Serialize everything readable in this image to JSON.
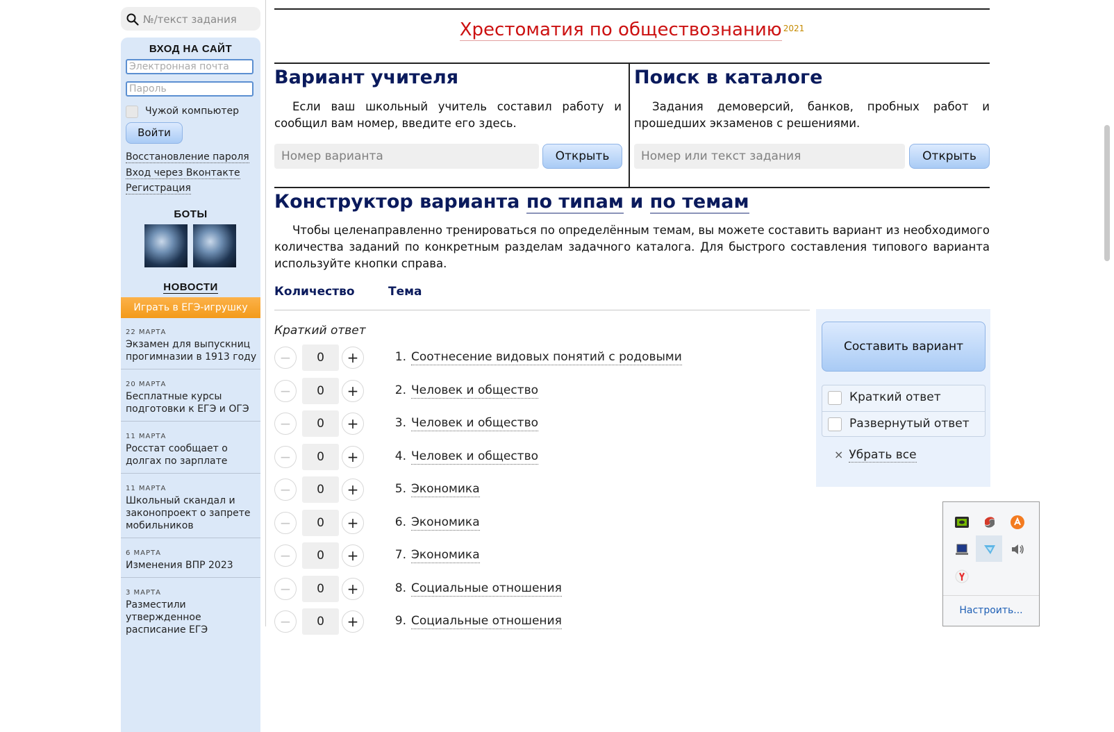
{
  "search": {
    "placeholder": "№/текст задания"
  },
  "login": {
    "heading": "ВХОД НА САЙТ",
    "email_placeholder": "Электронная почта",
    "password_placeholder": "Пароль",
    "remember_label": "Чужой компьютер",
    "submit_label": "Войти",
    "links": [
      "Восстановление пароля",
      "Вход через Вконтакте",
      "Регистрация"
    ]
  },
  "bots": {
    "heading": "БОТЫ"
  },
  "news": {
    "heading": "НОВОСТИ",
    "promo_label": "Играть в ЕГЭ-игрушку",
    "items": [
      {
        "date": "22 МАРТА",
        "title": "Экзамен для выпускниц прогимназии в 1913 году"
      },
      {
        "date": "20 МАРТА",
        "title": "Бесплатные курсы подготовки к ЕГЭ и ОГЭ"
      },
      {
        "date": "11 МАРТА",
        "title": "Росстат сообщает о долгах по зарплате"
      },
      {
        "date": "11 МАРТА",
        "title": "Школьный скандал и законопроект о запрете мобильников"
      },
      {
        "date": "6 МАРТА",
        "title": "Изменения ВПР 2023"
      },
      {
        "date": "3 МАРТА",
        "title": "Разместили утвержденное расписание ЕГЭ"
      }
    ]
  },
  "header": {
    "title": "Хрестоматия по обществознанию",
    "year": "2021"
  },
  "teacher_variant": {
    "heading": "Вариант учителя",
    "text": "Если ваш школьный учитель составил работу и сообщил вам номер, введите его здесь.",
    "input_placeholder": "Номер варианта",
    "button_label": "Открыть"
  },
  "catalog_search": {
    "heading": "Поиск в каталоге",
    "text": "Задания демоверсий, банков, пробных работ и прошедших экзаменов с решениями.",
    "input_placeholder": "Номер или текст задания",
    "button_label": "Открыть"
  },
  "constructor": {
    "heading_prefix": "Конструктор варианта",
    "by_types": "по типам",
    "and": "и",
    "by_topics": "по темам",
    "text": "Чтобы целенаправленно тренироваться по определённым темам, вы можете составить вариант из необходимого количества заданий по конкретным разделам задачного каталога. Для быстрого составления типового варианта используйте кнопки справа.",
    "col_quantity": "Количество",
    "col_topic": "Тема",
    "group_label": "Краткий ответ",
    "minus": "−",
    "plus": "+",
    "tasks": [
      {
        "num": "1.",
        "label": "Соотнесение видовых понятий с родовыми",
        "count": "0"
      },
      {
        "num": "2.",
        "label": "Человек и общество",
        "count": "0"
      },
      {
        "num": "3.",
        "label": "Человек и общество",
        "count": "0"
      },
      {
        "num": "4.",
        "label": "Человек и общество",
        "count": "0"
      },
      {
        "num": "5.",
        "label": "Экономика",
        "count": "0"
      },
      {
        "num": "6.",
        "label": "Экономика",
        "count": "0"
      },
      {
        "num": "7.",
        "label": "Экономика",
        "count": "0"
      },
      {
        "num": "8.",
        "label": "Социальные отношения",
        "count": "0"
      },
      {
        "num": "9.",
        "label": "Социальные отношения",
        "count": "0"
      }
    ]
  },
  "right_panel": {
    "make_label": "Составить вариант",
    "filters": [
      "Краткий ответ",
      "Развернутый ответ"
    ],
    "clear_label": "Убрать все",
    "clear_icon": "×"
  },
  "tray": {
    "configure_label": "Настроить...",
    "icons": [
      "nvidia-icon",
      "swirl-app-icon",
      "avast-icon",
      "laptop-icon",
      "network-icon",
      "speaker-icon",
      "yandex-icon"
    ]
  },
  "colors": {
    "accent_blue": "#a9cbf5",
    "title_red": "#cc1111",
    "heading_navy": "#0a1a5c",
    "promo_orange": "#f39a1a",
    "sidebar_bg": "#dbe8f8"
  }
}
